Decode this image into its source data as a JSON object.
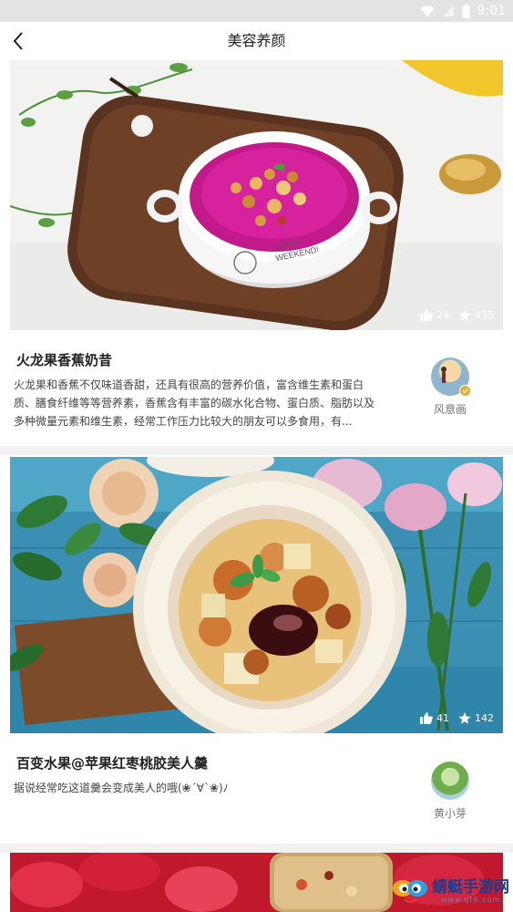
{
  "status_bar": {
    "time": "9:01"
  },
  "header": {
    "title": "美容养颜"
  },
  "recipes": [
    {
      "title": "火龙果香蕉奶昔",
      "description": "火龙果和香蕉不仅味道香甜，还具有很高的营养价值，富含维生素和蛋白质、膳食纤维等等营养素，香蕉含有丰富的碳水化合物、蛋白质、脂肪以及多种微量元素和维生素，经常工作压力比较大的朋友可以多食用，有...",
      "likes": "24",
      "favorites": "435",
      "author": "风意画",
      "bowl_text": "HAPPY WEEKEND!"
    },
    {
      "title": "百变水果@苹果红枣桃胶美人羹",
      "description": "据说经常吃这道羹会变成美人的哦(❀´∀`❀)ﾉ",
      "likes": "41",
      "favorites": "142",
      "author": "黄小芽"
    }
  ],
  "watermark": {
    "text": "蜻蜓手游网",
    "sub": "www.qt6.com"
  },
  "colors": {
    "status_bar": "#e3e3e3",
    "divider": "#f1f1f1",
    "title": "#222222"
  }
}
